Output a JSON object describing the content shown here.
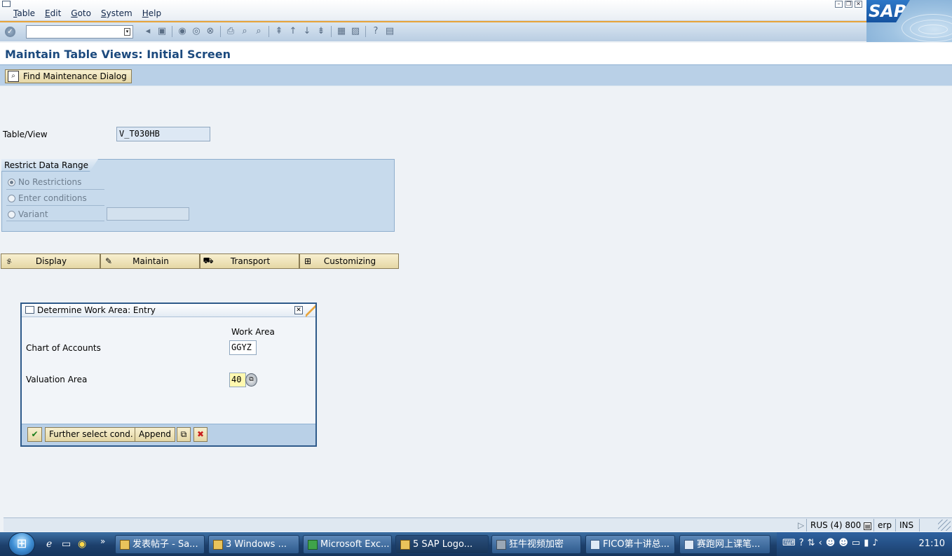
{
  "menu": {
    "items": [
      "Table",
      "Edit",
      "Goto",
      "System",
      "Help"
    ]
  },
  "toolbar": {
    "command_field_value": ""
  },
  "screen": {
    "title": "Maintain Table Views: Initial Screen",
    "find_button_label": "Find Maintenance Dialog"
  },
  "form": {
    "table_view_label": "Table/View",
    "table_view_value": "V_T030HB",
    "group_title": "Restrict Data Range",
    "radio_no_restrictions": "No Restrictions",
    "radio_enter_conditions": "Enter conditions",
    "radio_variant": "Variant",
    "selected_radio": "No Restrictions"
  },
  "actions": {
    "display": "Display",
    "maintain": "Maintain",
    "transport": "Transport",
    "customizing": "Customizing"
  },
  "popup": {
    "title": "Determine Work Area: Entry",
    "column_header": "Work Area",
    "chart_of_accounts_label": "Chart of Accounts",
    "chart_of_accounts_value": "GGYZ",
    "valuation_area_label": "Valuation Area",
    "valuation_area_value": "40",
    "further_select_button": "Further select cond.",
    "append_button": "Append"
  },
  "status": {
    "system": "RUS (4) 800",
    "server": "erp",
    "mode": "INS"
  },
  "taskbar": {
    "tasks": [
      {
        "label": "发表帖子 - Sa...",
        "active": false
      },
      {
        "label": "3 Windows ...",
        "active": false
      },
      {
        "label": "Microsoft Exc...",
        "active": false
      },
      {
        "label": "5 SAP Logo...",
        "active": true
      },
      {
        "label": "狂牛视频加密",
        "active": false
      },
      {
        "label": "FICO第十讲总...",
        "active": false
      },
      {
        "label": "赛跑网上课笔...",
        "active": false
      }
    ],
    "clock": "21:10"
  },
  "colors": {
    "title_blue": "#1c4a7e",
    "accent_orange": "#e8a43a",
    "appbar_blue": "#b9d0e7",
    "button_tan": "#e5d7a5",
    "required_yellow": "#fff8b0"
  },
  "icons": {
    "ok": "ok-check-icon",
    "save": "save-icon",
    "back": "back-icon",
    "exit": "exit-icon",
    "cancel": "cancel-icon",
    "print": "print-icon",
    "find": "find-icon",
    "help": "help-icon"
  }
}
